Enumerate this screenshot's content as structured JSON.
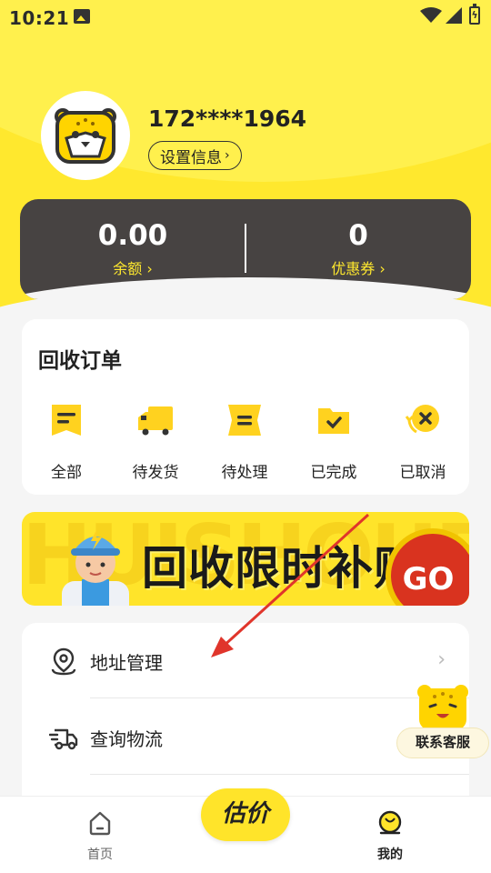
{
  "status_bar": {
    "time": "10:21",
    "battery_icon": "battery-charging-icon"
  },
  "profile": {
    "phone": "172****1964",
    "settings_label": "设置信息",
    "settings_chevron": "›"
  },
  "balance": {
    "amount": "0.00",
    "amount_label": "余额 ›",
    "coupons": "0",
    "coupons_label": "优惠券 ›"
  },
  "orders": {
    "title": "回收订单",
    "items": [
      {
        "label": "全部",
        "icon": "all-orders-icon"
      },
      {
        "label": "待发货",
        "icon": "truck-icon"
      },
      {
        "label": "待处理",
        "icon": "processing-icon"
      },
      {
        "label": "已完成",
        "icon": "completed-folder-icon"
      },
      {
        "label": "已取消",
        "icon": "cancel-icon"
      }
    ]
  },
  "banner": {
    "title": "回收限时补贴",
    "go_label": "GO",
    "background_text": "HUISHOUBAO"
  },
  "menu": {
    "items": [
      {
        "label": "地址管理",
        "icon": "location-pin-icon",
        "chevron": "›"
      },
      {
        "label": "查询物流",
        "icon": "delivery-truck-icon"
      }
    ]
  },
  "customer_service": {
    "label": "联系客服"
  },
  "nav": {
    "home_label": "首页",
    "estimate_label": "估价",
    "mine_label": "我的"
  },
  "colors": {
    "brand_yellow": "#ffe82e",
    "card_dark": "#474342",
    "annotation_red": "#e0352b"
  }
}
